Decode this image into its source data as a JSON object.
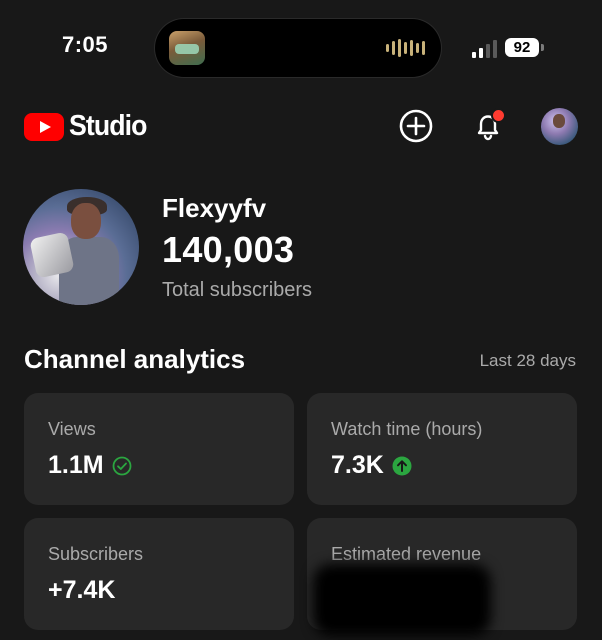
{
  "status_bar": {
    "time": "7:05",
    "battery": "92",
    "icons": [
      "now-playing-artwork",
      "audio-waveform-icon",
      "cellular-signal-icon",
      "battery-icon"
    ]
  },
  "header": {
    "logo_text": "Studio",
    "icons": [
      "youtube-logo-icon",
      "create-plus-icon",
      "notification-bell-icon",
      "account-avatar"
    ],
    "accent_color": "#FF0000",
    "notification_dot_color": "#FF3B30"
  },
  "profile": {
    "channel_name": "Flexyyfv",
    "subscriber_count": "140,003",
    "subscriber_label": "Total subscribers"
  },
  "analytics": {
    "title": "Channel analytics",
    "period": "Last 28 days",
    "cards": [
      {
        "label": "Views",
        "value": "1.1M",
        "indicator": "check-circle-icon",
        "indicator_color": "#2BA640"
      },
      {
        "label": "Watch time (hours)",
        "value": "7.3K",
        "indicator": "arrow-up-circle-icon",
        "indicator_color": "#2BA640"
      },
      {
        "label": "Subscribers",
        "value": "+7.4K"
      },
      {
        "label": "Estimated revenue",
        "value": ""
      }
    ]
  }
}
